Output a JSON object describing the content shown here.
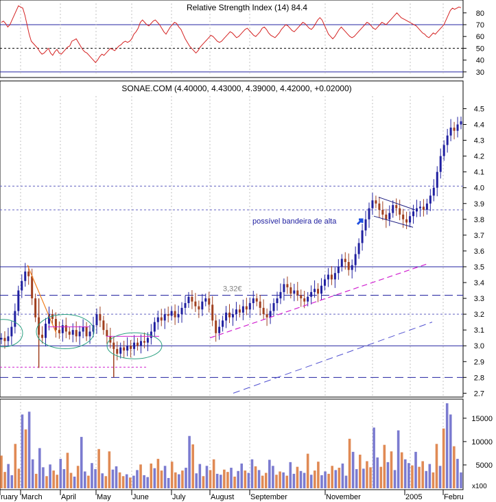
{
  "colors": {
    "rsi_line": "#d42020",
    "up_candle": "#2020a0",
    "down_candle": "#a04020",
    "volume_up": "#7b7bd0",
    "volume_down": "#e08a55",
    "support_line": "#2020a0",
    "trend_pink": "#d020d0",
    "trend_orange": "#f08020",
    "ellipse": "#2aa080",
    "grid": "#c0c0c0"
  },
  "chart_data": [
    {
      "type": "line",
      "panel": "rsi",
      "title": "Relative Strength Index (14) 84.4",
      "yticks": [
        30,
        40,
        50,
        60,
        70,
        80
      ],
      "ylim": [
        27,
        88
      ],
      "reference_lines": [
        30,
        50,
        70
      ],
      "values": [
        72,
        73,
        71,
        68,
        70,
        74,
        78,
        82,
        86,
        85,
        84,
        78,
        70,
        62,
        56,
        54,
        52,
        50,
        47,
        45,
        46,
        48,
        50,
        46,
        44,
        47,
        49,
        46,
        45,
        47,
        49,
        51,
        52,
        56,
        57,
        58,
        55,
        52,
        49,
        47,
        46,
        44,
        42,
        40,
        38,
        40,
        43,
        45,
        44,
        46,
        48,
        50,
        49,
        48,
        50,
        52,
        53,
        55,
        56,
        55,
        56,
        58,
        62,
        64,
        67,
        72,
        74,
        72,
        70,
        69,
        71,
        73,
        74,
        72,
        70,
        67,
        64,
        62,
        65,
        68,
        70,
        72,
        71,
        68,
        66,
        62,
        58,
        55,
        52,
        50,
        48,
        46,
        48,
        51,
        53,
        55,
        57,
        59,
        61,
        60,
        58,
        56,
        55,
        56,
        58,
        60,
        62,
        64,
        63,
        61,
        59,
        60,
        62,
        64,
        66,
        67,
        65,
        63,
        61,
        60,
        62,
        64,
        67,
        68,
        66,
        63,
        61,
        60,
        59,
        61,
        63,
        66,
        68,
        70,
        69,
        67,
        65,
        64,
        66,
        68,
        70,
        72,
        71,
        69,
        67,
        66,
        68,
        71,
        74,
        76,
        74,
        70,
        66,
        62,
        60,
        58,
        60,
        63,
        66,
        68,
        66,
        64,
        62,
        60,
        59,
        60,
        62,
        64,
        66,
        68,
        70,
        72,
        71,
        69,
        67,
        66,
        68,
        70,
        72,
        71,
        70,
        72,
        74,
        76,
        78,
        80,
        78,
        76,
        75,
        74,
        73,
        72,
        71,
        70,
        69,
        67,
        65,
        63,
        62,
        60,
        59,
        61,
        63,
        62,
        64,
        66,
        68,
        70,
        74,
        78,
        82,
        84,
        83,
        84,
        85,
        84.4
      ]
    },
    {
      "type": "candlestick",
      "panel": "price",
      "title": "SONAE.COM (4.40000, 4.43000, 4.39000, 4.42000, +0.02000)",
      "yticks": [
        2.7,
        2.8,
        2.9,
        3.0,
        3.1,
        3.2,
        3.3,
        3.4,
        3.5,
        3.6,
        3.7,
        3.8,
        3.9,
        4.0,
        4.1,
        4.2,
        4.3,
        4.4,
        4.5
      ],
      "ylim": [
        2.68,
        4.58
      ],
      "annotations": [
        {
          "text": "3,32€",
          "price": 3.32
        },
        {
          "text": "possível bandeira de alta",
          "price": 3.79
        }
      ],
      "close": [
        3.05,
        3.03,
        3.06,
        3.12,
        3.22,
        3.35,
        3.41,
        3.47,
        3.44,
        3.3,
        3.18,
        3.07,
        3.05,
        3.14,
        3.2,
        3.17,
        3.1,
        3.08,
        3.13,
        3.09,
        3.07,
        3.1,
        3.06,
        3.09,
        3.12,
        3.06,
        3.09,
        3.13,
        3.2,
        3.16,
        3.1,
        3.06,
        3.02,
        2.98,
        2.95,
        2.99,
        2.97,
        3.0,
        2.98,
        3.02,
        3.0,
        3.03,
        3.02,
        3.05,
        3.09,
        3.15,
        3.18,
        3.16,
        3.2,
        3.19,
        3.22,
        3.18,
        3.2,
        3.24,
        3.27,
        3.31,
        3.28,
        3.25,
        3.23,
        3.28,
        3.3,
        3.26,
        3.16,
        3.08,
        3.12,
        3.16,
        3.21,
        3.18,
        3.2,
        3.23,
        3.21,
        3.25,
        3.23,
        3.27,
        3.3,
        3.28,
        3.24,
        3.2,
        3.18,
        3.22,
        3.27,
        3.3,
        3.34,
        3.39,
        3.37,
        3.33,
        3.35,
        3.32,
        3.3,
        3.28,
        3.31,
        3.34,
        3.36,
        3.33,
        3.38,
        3.42,
        3.45,
        3.42,
        3.46,
        3.5,
        3.55,
        3.53,
        3.48,
        3.51,
        3.58,
        3.65,
        3.73,
        3.8,
        3.87,
        3.92,
        3.9,
        3.86,
        3.83,
        3.8,
        3.84,
        3.89,
        3.87,
        3.83,
        3.8,
        3.78,
        3.82,
        3.85,
        3.87,
        3.88,
        3.86,
        3.9,
        3.95,
        4.0,
        4.1,
        4.2,
        4.27,
        4.33,
        4.38,
        4.36,
        4.4,
        4.42
      ],
      "lines": [
        {
          "kind": "horizontal",
          "price": 3.0,
          "style": "solid"
        },
        {
          "kind": "horizontal",
          "price": 3.5,
          "style": "solid"
        },
        {
          "kind": "horizontal",
          "price": 3.32,
          "style": "dashed"
        },
        {
          "kind": "horizontal",
          "price": 2.8,
          "style": "dashed"
        },
        {
          "kind": "horizontal",
          "price": 3.2,
          "style": "dotted"
        },
        {
          "kind": "horizontal",
          "price": 3.86,
          "style": "dotted"
        },
        {
          "kind": "horizontal",
          "price": 4.01,
          "style": "dotted"
        }
      ]
    },
    {
      "type": "bar",
      "panel": "volume",
      "unit": "x100",
      "yticks": [
        5000,
        10000,
        15000
      ],
      "ylim": [
        0,
        18500
      ],
      "values": [
        7000,
        3500,
        5200,
        2800,
        9500,
        4200,
        15800,
        12600,
        16400,
        6200,
        3100,
        8600,
        4500,
        2600,
        5100,
        3800,
        2900,
        6300,
        4100,
        7600,
        3300,
        2500,
        4800,
        11000,
        3600,
        2700,
        5400,
        4100,
        8400,
        3200,
        2600,
        7900,
        4000,
        4700,
        3400,
        2600,
        3000,
        2300,
        2700,
        3900,
        5100,
        2800,
        2400,
        5300,
        4300,
        6300,
        3800,
        4800,
        2200,
        5700,
        3400,
        3000,
        3800,
        4400,
        11200,
        9400,
        3200,
        5200,
        2600,
        4800,
        3900,
        6200,
        3100,
        2900,
        4000,
        3500,
        4400,
        2500,
        3700,
        5300,
        3800,
        3300,
        6200,
        4700,
        3900,
        2700,
        3300,
        6100,
        4800,
        2900,
        3600,
        3400,
        2700,
        5600,
        3100,
        4600,
        3700,
        3300,
        7400,
        2900,
        3800,
        5700,
        2800,
        3600,
        3100,
        4800,
        3900,
        4400,
        5300,
        2700,
        10600,
        7800,
        4100,
        7200,
        4200,
        5800,
        4500,
        13000,
        6600,
        4600,
        9300,
        5600,
        7900,
        3900,
        12400,
        7700,
        6200,
        5400,
        4900,
        7800,
        4600,
        5800,
        3700,
        5200,
        3400,
        9500,
        4800,
        12800,
        18200,
        15800,
        9000,
        6300,
        3400
      ]
    }
  ],
  "x_axis_labels": [
    "ruary",
    "March",
    "April",
    "May",
    "June",
    "July",
    "August",
    "September",
    "November",
    "2005",
    "Febru"
  ],
  "volume_unit_label": "x100"
}
